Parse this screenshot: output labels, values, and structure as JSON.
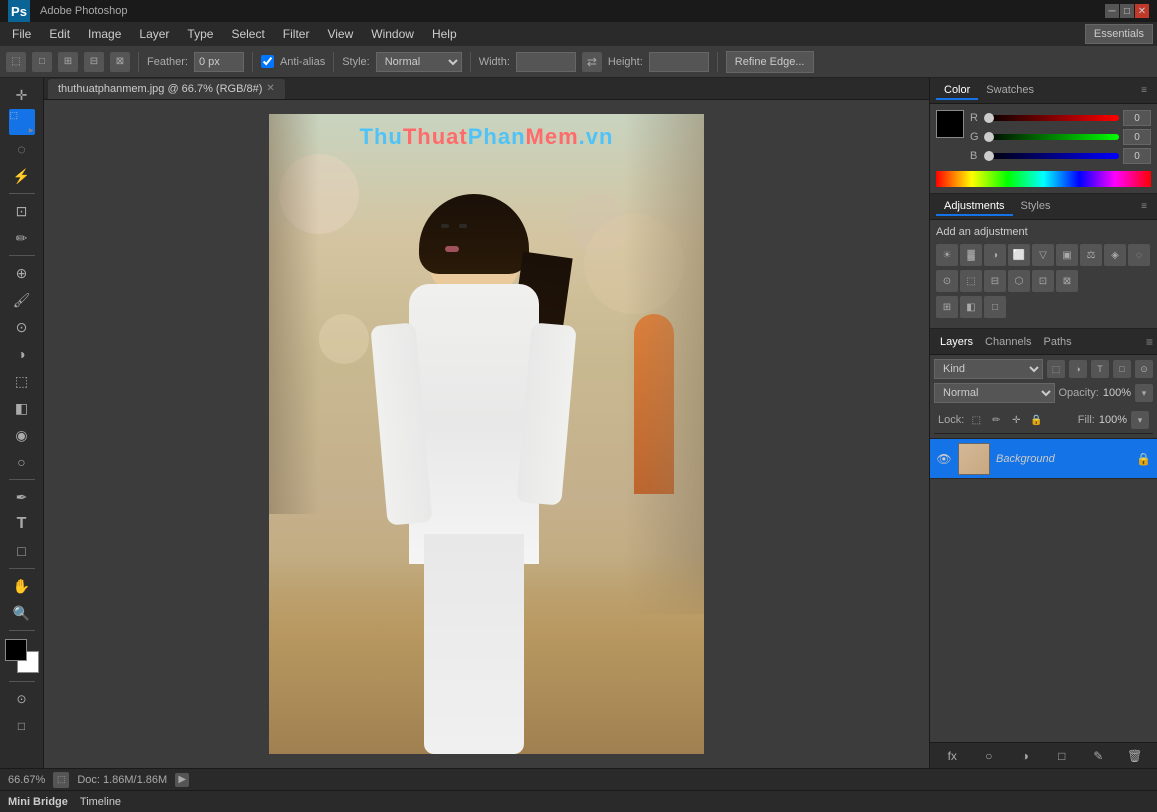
{
  "titlebar": {
    "logo": "Ps",
    "title": "Adobe Photoshop",
    "min_btn": "─",
    "max_btn": "□",
    "close_btn": "✕"
  },
  "menubar": {
    "items": [
      "File",
      "Edit",
      "Image",
      "Layer",
      "Type",
      "Select",
      "Filter",
      "View",
      "Window",
      "Help"
    ]
  },
  "optionsbar": {
    "feather_label": "Feather:",
    "feather_value": "0 px",
    "antialias_label": "Anti-alias",
    "style_label": "Style:",
    "style_value": "Normal",
    "width_label": "Width:",
    "height_label": "Height:",
    "refine_edge_btn": "Refine Edge...",
    "essentials_btn": "Essentials"
  },
  "tab": {
    "name": "thuthuatphanmem.jpg @ 66.7% (RGB/8#)",
    "close": "✕"
  },
  "canvas": {
    "watermark": "ThuThuatPhanMem.vn"
  },
  "color_panel": {
    "tab1": "Color",
    "tab2": "Swatches",
    "r_label": "R",
    "r_value": "0",
    "g_label": "G",
    "g_value": "0",
    "b_label": "B",
    "b_value": "0"
  },
  "adjustments_panel": {
    "tab1": "Adjustments",
    "tab2": "Styles",
    "title": "Add an adjustment",
    "icons": [
      "☀",
      "◑",
      "◧",
      "⊞",
      "▽",
      "▣",
      "⚖",
      "◈",
      "◌",
      "⊙",
      "⬚",
      "⊟",
      "⬡",
      "⊡",
      "⊠",
      "⊞"
    ]
  },
  "layers_panel": {
    "tab1": "Layers",
    "tab2": "Channels",
    "tab3": "Paths",
    "filter_label": "Kind",
    "blend_mode": "Normal",
    "opacity_label": "Opacity:",
    "opacity_value": "100%",
    "lock_label": "Lock:",
    "fill_label": "Fill:",
    "fill_value": "100%",
    "background_layer": "Background",
    "footer_btns": [
      "fx",
      "○",
      "□",
      "✎",
      "🗑"
    ]
  },
  "statusbar": {
    "zoom": "66.67%",
    "doc_label": "Doc: 1.86M/1.86M"
  },
  "minibridge": {
    "tab1": "Mini Bridge",
    "tab2": "Timeline"
  },
  "tools": {
    "move": "✛",
    "marquee": "⬚",
    "lasso": "◌",
    "wand": "⚡",
    "crop": "⊡",
    "eyedropper": "✏",
    "healing": "⊕",
    "brush": "🖌",
    "clone": "⊙",
    "history": "◑",
    "eraser": "⬚",
    "gradient": "◧",
    "blur": "◉",
    "dodge": "○",
    "pen": "✒",
    "text": "T",
    "shape": "□",
    "hand": "✋",
    "zoom": "🔍"
  }
}
